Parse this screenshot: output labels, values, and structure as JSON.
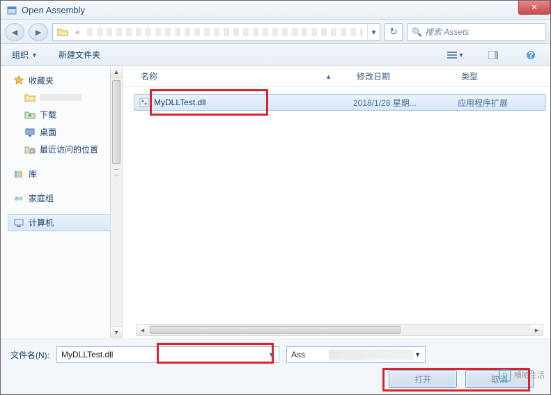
{
  "window": {
    "title": "Open Assembly"
  },
  "search": {
    "placeholder": "搜索 Assets"
  },
  "toolbar": {
    "organize": "组织",
    "newfolder": "新建文件夹"
  },
  "sidebar": {
    "favorites": "收藏夹",
    "blurred": "",
    "downloads": "下载",
    "desktop": "桌面",
    "recent": "最近访问的位置",
    "libraries": "库",
    "homegroup": "家庭组",
    "computer": "计算机"
  },
  "columns": {
    "name": "名称",
    "date": "修改日期",
    "type": "类型"
  },
  "files": [
    {
      "name": "MyDLLTest.dll",
      "date": "2018/1/28 星期...",
      "type": "应用程序扩展"
    }
  ],
  "footer": {
    "filename_label": "文件名(N):",
    "filename_value": "MyDLLTest.dll",
    "filter_prefix": "Ass",
    "open_label": "打开",
    "cancel_label": "取消"
  },
  "watermark": {
    "brand": "嘻哈生活",
    "site": ""
  }
}
